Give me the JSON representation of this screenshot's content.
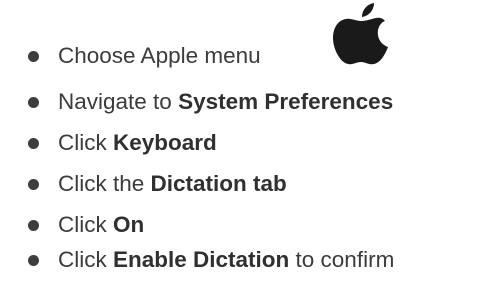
{
  "steps": [
    {
      "prefix": "Choose Apple menu",
      "strong": "",
      "suffix": "",
      "icon": "apple-logo-icon"
    },
    {
      "prefix": "Navigate to ",
      "strong": "System Preferences",
      "suffix": ""
    },
    {
      "prefix": "Click ",
      "strong": "Keyboard",
      "suffix": ""
    },
    {
      "prefix": "Click the ",
      "strong": "Dictation tab",
      "suffix": ""
    },
    {
      "prefix": "Click ",
      "strong": "On",
      "suffix": ""
    },
    {
      "prefix": "Click ",
      "strong": "Enable Dictation",
      "suffix": " to confirm"
    }
  ],
  "colors": {
    "text": "#3b3b3b",
    "bullet": "#3d3d3d",
    "icon": "#1a1a1a"
  }
}
